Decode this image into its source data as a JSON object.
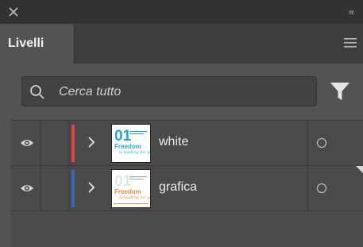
{
  "window": {
    "close_icon": "close-icon",
    "collapse_icon": "collapse-chevrons-icon",
    "collapse_text": "‹‹"
  },
  "panel": {
    "tab_label": "Livelli",
    "menu_icon": "hamburger-menu-icon"
  },
  "search": {
    "placeholder": "Cerca tutto",
    "value": "",
    "icon": "search-icon",
    "filter_icon": "filter-icon"
  },
  "layers": [
    {
      "name": "white",
      "color": "#e0434a",
      "visible": true,
      "expanded": false
    },
    {
      "name": "grafica",
      "color": "#3f63b8",
      "visible": true,
      "expanded": false
    }
  ],
  "colors": {
    "titlebar": "#323232",
    "panel_bg": "#535353",
    "tab_strip": "#3e3e3e",
    "row_bg": "#4a4a4a",
    "text": "#e8e8e8",
    "thumb_accent_blue": "#1ea7e0",
    "thumb_accent_orange": "#f0873a"
  }
}
